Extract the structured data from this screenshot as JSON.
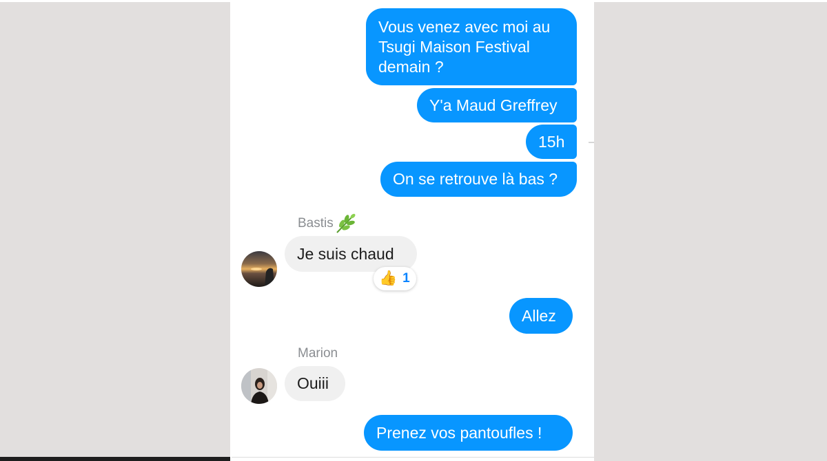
{
  "messages": {
    "m1": "Vous venez avec moi au Tsugi Maison Festival demain ?",
    "m2": "Y'a Maud Greffrey",
    "m3": "15h",
    "m4": "On se retrouve là bas ?",
    "m5": "Je suis chaud",
    "m6": "Allez",
    "m7": "Ouiii",
    "m8": "Prenez vos pantoufles !"
  },
  "senders": {
    "bastis": "Bastis",
    "marion": "Marion"
  },
  "reaction": {
    "icon": "thumbs-up-icon",
    "emoji": "👍",
    "count": "1"
  },
  "colors": {
    "outgoing_bubble": "#0896ff",
    "incoming_bubble": "#f0f0f0",
    "reaction_count": "#0a84ff",
    "sender_name": "#8a8d91"
  }
}
